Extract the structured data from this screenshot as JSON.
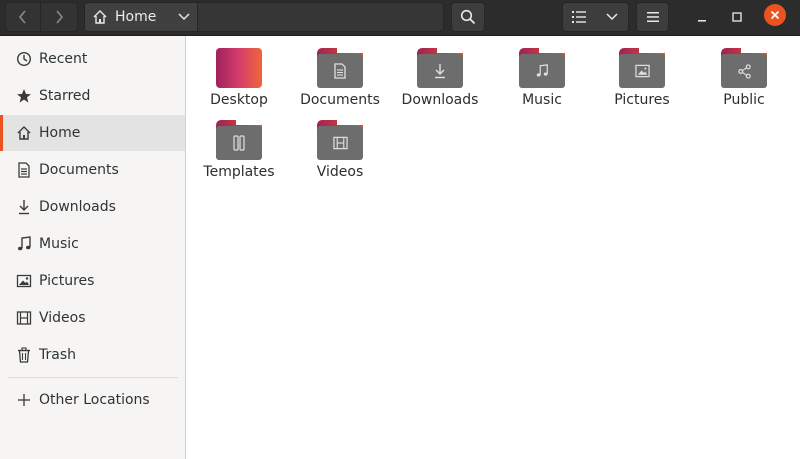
{
  "header": {
    "path": {
      "label": "Home"
    }
  },
  "sidebar": {
    "items": [
      {
        "label": "Recent",
        "icon": "clock-icon"
      },
      {
        "label": "Starred",
        "icon": "star-icon"
      },
      {
        "label": "Home",
        "icon": "home-icon",
        "active": true
      },
      {
        "label": "Documents",
        "icon": "document-icon"
      },
      {
        "label": "Downloads",
        "icon": "download-icon"
      },
      {
        "label": "Music",
        "icon": "music-note-icon"
      },
      {
        "label": "Pictures",
        "icon": "image-icon"
      },
      {
        "label": "Videos",
        "icon": "film-icon"
      },
      {
        "label": "Trash",
        "icon": "trash-icon"
      }
    ],
    "other": {
      "label": "Other Locations",
      "icon": "plus-icon"
    }
  },
  "content": {
    "items": [
      {
        "label": "Desktop",
        "icon": "desktop-folder-icon"
      },
      {
        "label": "Documents",
        "icon": "document-icon"
      },
      {
        "label": "Downloads",
        "icon": "download-icon"
      },
      {
        "label": "Music",
        "icon": "music-note-icon"
      },
      {
        "label": "Pictures",
        "icon": "image-icon"
      },
      {
        "label": "Public",
        "icon": "share-icon"
      },
      {
        "label": "Templates",
        "icon": "template-icon"
      },
      {
        "label": "Videos",
        "icon": "film-icon"
      }
    ]
  },
  "colors": {
    "accent": "#e95420",
    "folder_gradient_start": "#a0215a",
    "headerbar": "#2c2c2c",
    "sidebar_bg": "#f6f5f4"
  }
}
